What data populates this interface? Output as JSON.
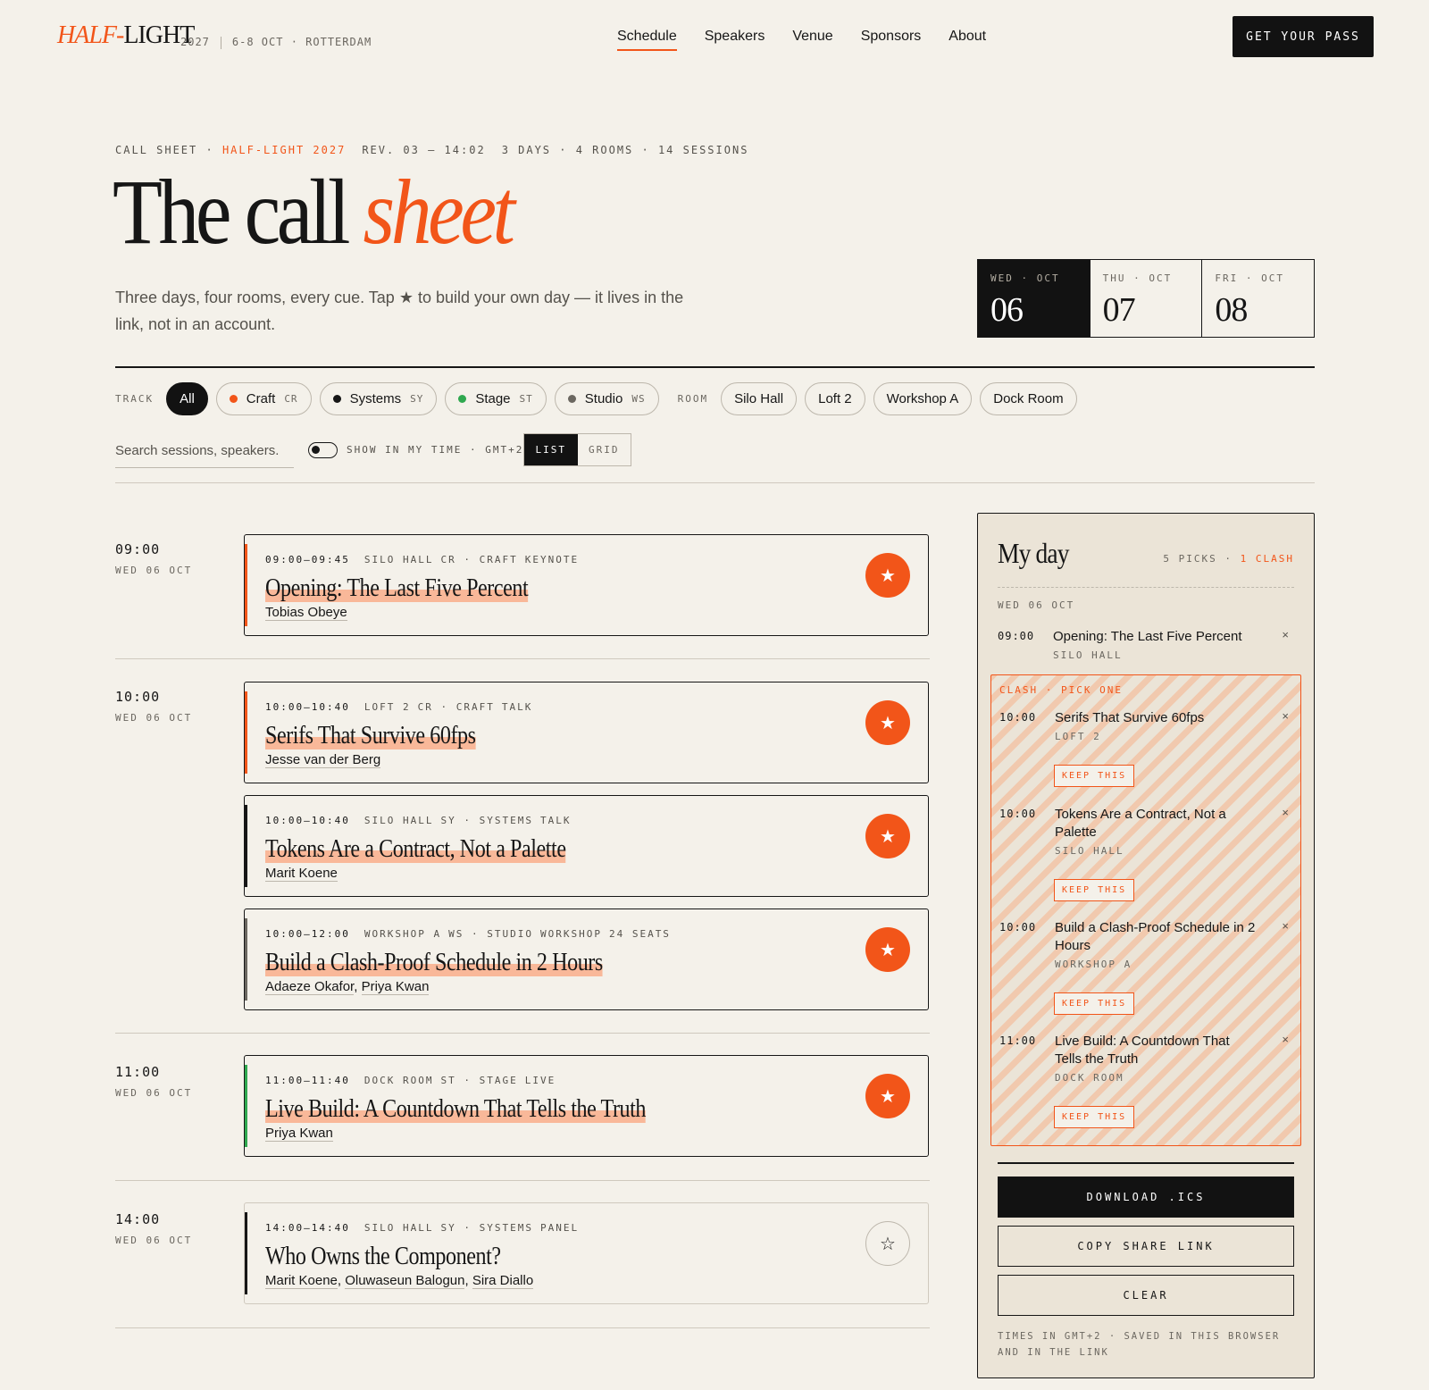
{
  "brand": {
    "half": "HALF",
    "dash": "-",
    "light": "LIGHT",
    "year": "2027",
    "when": "6-8 OCT · ROTTERDAM"
  },
  "nav": {
    "items": [
      "Schedule",
      "Speakers",
      "Venue",
      "Sponsors",
      "About"
    ],
    "active": "Schedule",
    "cta": "GET YOUR PASS"
  },
  "hero": {
    "eyebrow_a": "CALL SHEET ·",
    "eyebrow_b": "HALF-LIGHT 2027",
    "eyebrow_c": "REV. 03 — 14:02",
    "eyebrow_d": "3 DAYS · 4 ROOMS · 14 SESSIONS",
    "title_a": "The call",
    "title_b": "sheet",
    "subtitle": "Three days, four rooms, every cue. Tap ★ to build your own day — it lives in the link, not in an account."
  },
  "days": [
    {
      "label": "WED · OCT",
      "num": "06",
      "selected": true
    },
    {
      "label": "THU · OCT",
      "num": "07"
    },
    {
      "label": "FRI · OCT",
      "num": "08"
    }
  ],
  "filters": {
    "track_label": "TRACK",
    "all": "All",
    "tracks": [
      {
        "name": "Craft",
        "code": "CR",
        "color": "#f25519"
      },
      {
        "name": "Systems",
        "code": "SY",
        "color": "#161616"
      },
      {
        "name": "Stage",
        "code": "ST",
        "color": "#2fa84f"
      },
      {
        "name": "Studio",
        "code": "WS",
        "color": "#6b6760"
      }
    ],
    "room_label": "ROOM",
    "rooms": [
      "Silo Hall",
      "Loft 2",
      "Workshop A",
      "Dock Room"
    ],
    "search_placeholder": "Search sessions, speakers.",
    "toggle_label": "SHOW IN MY TIME · GMT+2",
    "view": [
      "LIST",
      "GRID"
    ]
  },
  "slots": [
    {
      "time": "09:00",
      "day": "WED 06 OCT"
    },
    {
      "time": "10:00",
      "day": "WED 06 OCT"
    },
    {
      "time": "11:00",
      "day": "WED 06 OCT"
    },
    {
      "time": "14:00",
      "day": "WED 06 OCT"
    }
  ],
  "sessions": [
    {
      "range": "09:00–09:45",
      "room": "SILO HALL",
      "code": "CR",
      "track": "CRAFT",
      "kind": "KEYNOTE",
      "title": "Opening: The Last Five Percent",
      "speakers": [
        "Tobias Obeye"
      ],
      "starred": true,
      "color": "#f25519"
    },
    {
      "range": "10:00–10:40",
      "room": "LOFT 2",
      "code": "CR",
      "track": "CRAFT",
      "kind": "TALK",
      "title": "Serifs That Survive 60fps",
      "speakers": [
        "Jesse van der Berg"
      ],
      "starred": true,
      "color": "#f25519"
    },
    {
      "range": "10:00–10:40",
      "room": "SILO HALL",
      "code": "SY",
      "track": "SYSTEMS",
      "kind": "TALK",
      "title": "Tokens Are a Contract, Not a Palette",
      "speakers": [
        "Marit Koene"
      ],
      "starred": true,
      "color": "#161616"
    },
    {
      "range": "10:00–12:00",
      "room": "WORKSHOP A",
      "code": "WS",
      "track": "STUDIO",
      "kind": "WORKSHOP",
      "extra": "24 SEATS",
      "title": "Build a Clash-Proof Schedule in 2 Hours",
      "speakers": [
        "Adaeze Okafor",
        "Priya Kwan"
      ],
      "starred": true,
      "color": "#6b6760"
    },
    {
      "range": "11:00–11:40",
      "room": "DOCK ROOM",
      "code": "ST",
      "track": "STAGE",
      "kind": "LIVE",
      "title": "Live Build: A Countdown That Tells the Truth",
      "speakers": [
        "Priya Kwan"
      ],
      "starred": true,
      "color": "#2fa84f"
    },
    {
      "range": "14:00–14:40",
      "room": "SILO HALL",
      "code": "SY",
      "track": "SYSTEMS",
      "kind": "PANEL",
      "title": "Who Owns the Component?",
      "speakers": [
        "Marit Koene",
        "Oluwaseun Balogun",
        "Sira Diallo"
      ],
      "starred": false,
      "color": "#161616"
    }
  ],
  "myday": {
    "title": "My day",
    "picks": "5 PICKS ·",
    "clashes": "1 CLASH",
    "day": "WED 06 OCT",
    "first": {
      "time": "09:00",
      "title": "Opening: The Last Five Percent",
      "room": "SILO HALL"
    },
    "clash_label": "CLASH · PICK ONE",
    "clash_items": [
      {
        "time": "10:00",
        "title": "Serifs That Survive 60fps",
        "room": "LOFT 2"
      },
      {
        "time": "10:00",
        "title": "Tokens Are a Contract, Not a Palette",
        "room": "SILO HALL"
      },
      {
        "time": "10:00",
        "title": "Build a Clash-Proof Schedule in 2 Hours",
        "room": "WORKSHOP A"
      },
      {
        "time": "11:00",
        "title": "Live Build: A Countdown That Tells the Truth",
        "room": "DOCK ROOM"
      }
    ],
    "keep": "KEEP THIS",
    "remove": "×",
    "download": "DOWNLOAD .ICS",
    "share": "COPY SHARE LINK",
    "clear": "CLEAR",
    "foot": "TIMES IN GMT+2 · SAVED IN THIS BROWSER AND IN THE LINK"
  }
}
